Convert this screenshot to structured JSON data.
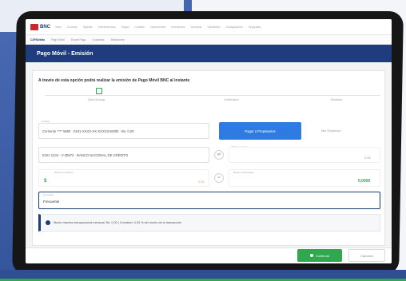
{
  "nav": {
    "logo_text": "BNC",
    "items": [
      "Inicio",
      "Cuentas",
      "Tarjetas",
      "Transferencias",
      "Pagos",
      "Créditos",
      "Operaciones",
      "Inversiones",
      "Servicios",
      "Solicitudes",
      "Configuración",
      "Seguridad"
    ]
  },
  "subnav": {
    "items": [
      "C2P/Débito",
      "Pago Móvil",
      "Enviar Pago",
      "Consultas",
      "Afiliaciones"
    ]
  },
  "page": {
    "title": "Pago Móvil - Emisión"
  },
  "form": {
    "instruction": "A través de esta opción podrá realizar la emisión de Pago Móvil BNC al instante",
    "steps": [
      "Datos del pago",
      "Confirmación",
      "Resultado"
    ],
    "account_label": "Cuenta",
    "account_value": "Corriente **** 5683 · 0191-XXXX-XX-XXXXXX0000 · Bs. 0,00",
    "pay_button": "Pagar a Propietarios",
    "link_text": "Mis Registros",
    "beneficiary_value": "0191-1234 · V-30872 · BANCO NACIONAL DE CRÉDITO",
    "amount_label_right": "Monto a enviar",
    "amount_right": "0,00",
    "rate_label": "Monto en Dólares",
    "rate_value": "0,00",
    "total_label": "Monto en Bolívares",
    "total_value": "0,0000",
    "concept_label": "Concepto",
    "concept_value": "Frecuente",
    "info_text": "Monto máximo transaccional mensual: Bs. 0,00 | Comisión: 0,00 % del monto de la transacción"
  },
  "footer": {
    "primary_button": "Continuar",
    "secondary_button": "Cancelar"
  }
}
